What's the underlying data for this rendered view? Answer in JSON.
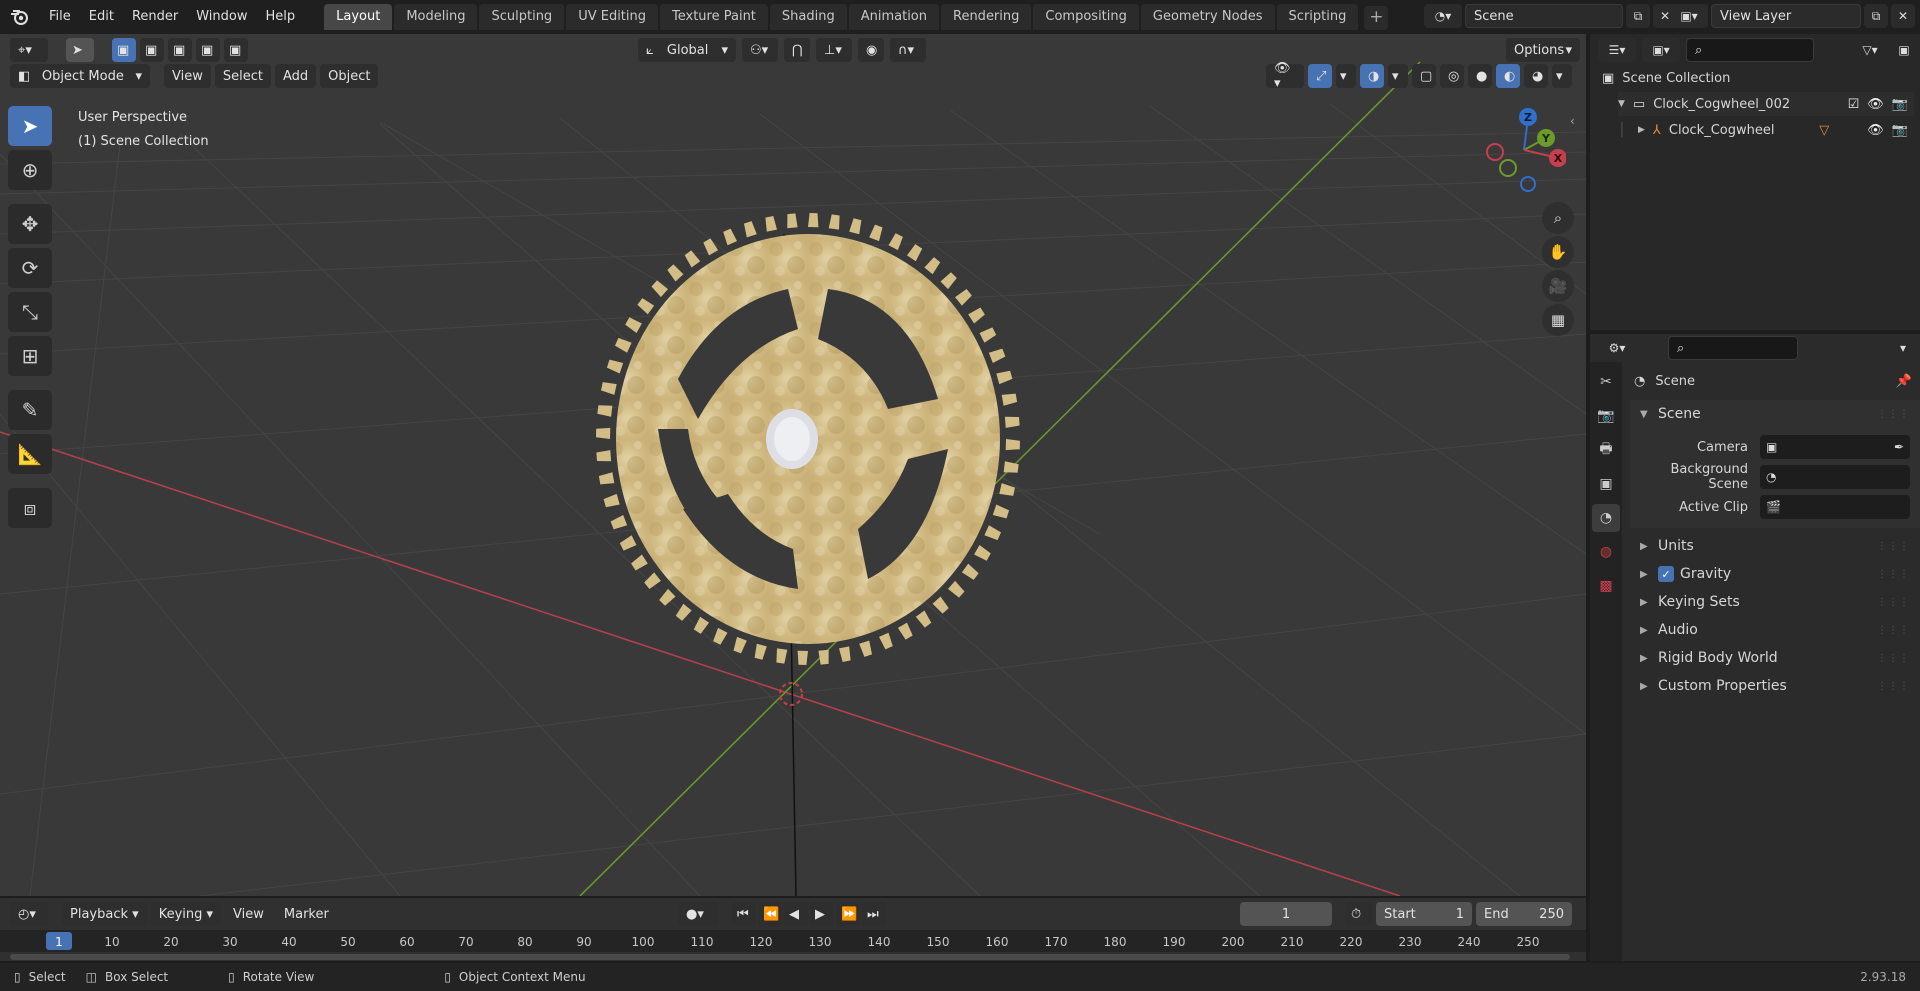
{
  "top_menu": {
    "logo": "blender-logo-icon",
    "items": [
      "File",
      "Edit",
      "Render",
      "Window",
      "Help"
    ]
  },
  "workspaces": [
    {
      "label": "Layout",
      "active": true
    },
    {
      "label": "Modeling",
      "active": false
    },
    {
      "label": "Sculpting",
      "active": false
    },
    {
      "label": "UV Editing",
      "active": false
    },
    {
      "label": "Texture Paint",
      "active": false
    },
    {
      "label": "Shading",
      "active": false
    },
    {
      "label": "Animation",
      "active": false
    },
    {
      "label": "Rendering",
      "active": false
    },
    {
      "label": "Compositing",
      "active": false
    },
    {
      "label": "Geometry Nodes",
      "active": false
    },
    {
      "label": "Scripting",
      "active": false
    }
  ],
  "scene_selector": {
    "value": "Scene"
  },
  "view_layer_selector": {
    "value": "View Layer"
  },
  "viewport": {
    "transform_orientation": "Global",
    "options_label": "Options",
    "mode": "Object Mode",
    "menus": [
      "View",
      "Select",
      "Add",
      "Object"
    ],
    "overlay_text": {
      "line1": "User Perspective",
      "line2": "(1) Scene Collection"
    },
    "gizmo_axes": {
      "z": "Z",
      "y": "Y",
      "x": "X"
    },
    "colors": {
      "x_axis": "#c5404e",
      "y_axis": "#6d9a2c",
      "z_axis": "#2f6fce",
      "accent": "#4772b3",
      "gear": "#d8c493"
    }
  },
  "outliner": {
    "root": "Scene Collection",
    "items": [
      {
        "label": "Clock_Cogwheel_002",
        "level": 1
      },
      {
        "label": "Clock_Cogwheel",
        "level": 2
      }
    ]
  },
  "properties": {
    "context": "Scene",
    "section": "Scene",
    "fields": [
      {
        "label": "Camera",
        "value": ""
      },
      {
        "label": "Background Scene",
        "value": ""
      },
      {
        "label": "Active Clip",
        "value": ""
      }
    ],
    "panels": [
      "Units",
      "Gravity",
      "Keying Sets",
      "Audio",
      "Rigid Body World",
      "Custom Properties"
    ]
  },
  "timeline": {
    "menus": [
      "Playback",
      "Keying",
      "View",
      "Marker"
    ],
    "current_frame": "1",
    "start_label": "Start",
    "start_value": "1",
    "end_label": "End",
    "end_value": "250",
    "ticks": [
      "1",
      "10",
      "20",
      "30",
      "40",
      "50",
      "60",
      "70",
      "80",
      "90",
      "100",
      "110",
      "120",
      "130",
      "140",
      "150",
      "160",
      "170",
      "180",
      "190",
      "200",
      "210",
      "220",
      "230",
      "240",
      "250"
    ]
  },
  "statusbar": {
    "items": [
      "Select",
      "Box Select",
      "Rotate View",
      "Object Context Menu"
    ],
    "version": "2.93.18"
  }
}
